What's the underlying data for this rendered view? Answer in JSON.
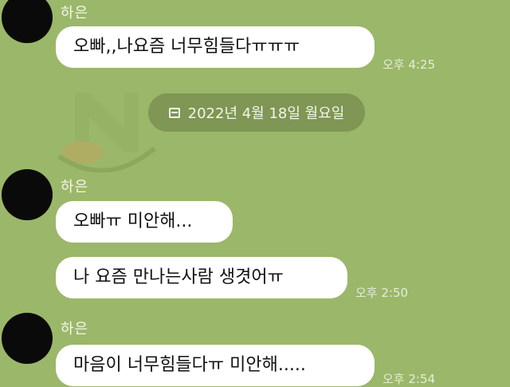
{
  "colors": {
    "background": "#9bb76a",
    "bubble": "#ffffff",
    "date_pill": "#7f9654",
    "avatar": "#0a0a0a"
  },
  "chat": {
    "groups": [
      {
        "sender": "하은",
        "messages": [
          "오빠,,나요즘 너무힘들다ㅠㅠㅠ"
        ],
        "time": "오후 4:25"
      },
      {
        "sender": "하은",
        "messages": [
          "오빠ㅠ 미안해...",
          "나 요즘 만나는사람 생겻어ㅠ"
        ],
        "time": "오후 2:50"
      },
      {
        "sender": "하은",
        "messages": [
          "마음이 너무힘들다ㅠ 미안해....."
        ],
        "time": "오후 2:54"
      }
    ],
    "date_divider": {
      "icon": "calendar-icon",
      "label": "2022년 4월 18일 월요일"
    }
  }
}
